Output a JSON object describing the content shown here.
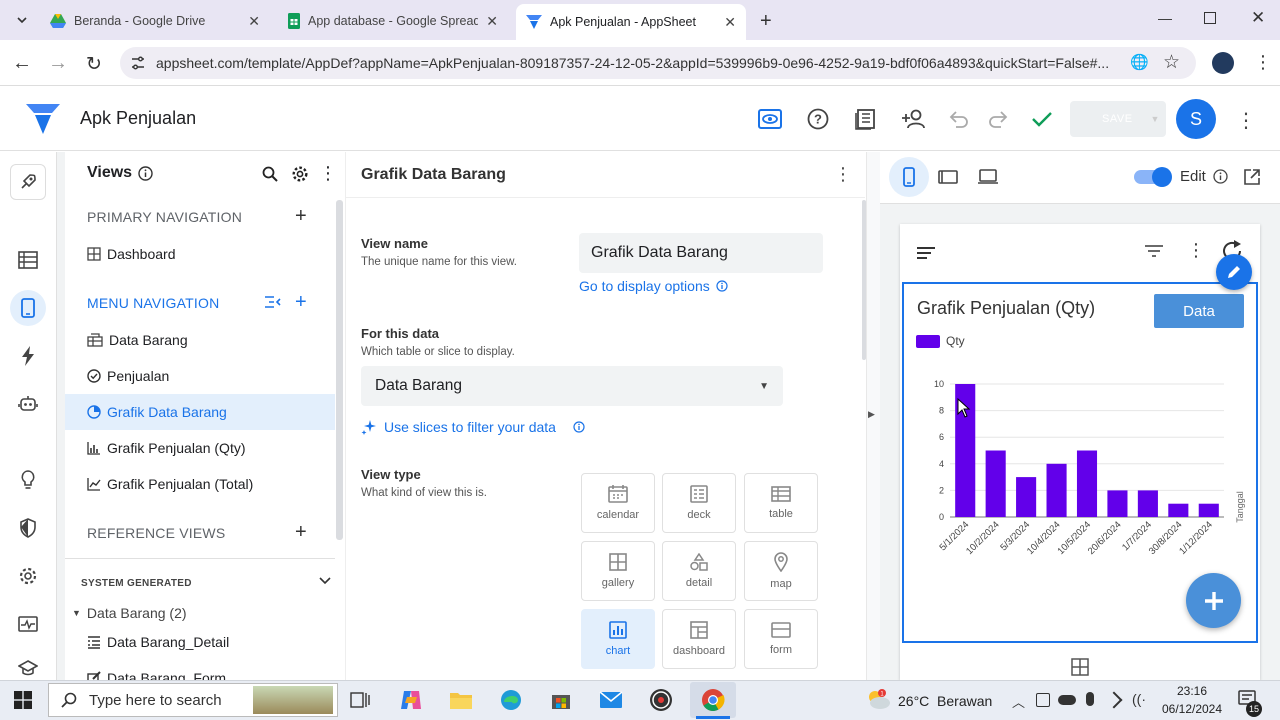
{
  "browser": {
    "tabs": [
      {
        "title": "Beranda - Google Drive",
        "icon": "google-drive-icon",
        "active": false
      },
      {
        "title": "App database - Google Spread",
        "icon": "google-sheets-icon",
        "active": false
      },
      {
        "title": "Apk Penjualan - AppSheet",
        "icon": "appsheet-icon",
        "active": true
      }
    ],
    "url": "appsheet.com/template/AppDef?appName=ApkPenjualan-809187357-24-12-05-2&appId=539996b9-0e96-4252-9a19-bdf0f06a4893&quickStart=False#..."
  },
  "app": {
    "title": "Apk Penjualan",
    "save_label": "SAVE",
    "avatar_letter": "S"
  },
  "views_panel": {
    "title": "Views",
    "primary_nav_label": "PRIMARY NAVIGATION",
    "primary_items": [
      {
        "label": "Dashboard",
        "icon": "grid-icon"
      }
    ],
    "menu_nav_label": "MENU NAVIGATION",
    "menu_items": [
      {
        "label": "Data Barang",
        "icon": "table-icon"
      },
      {
        "label": "Penjualan",
        "icon": "check-circle-icon"
      },
      {
        "label": "Grafik Data Barang",
        "icon": "pie-chart-icon",
        "selected": true
      },
      {
        "label": "Grafik Penjualan (Qty)",
        "icon": "bar-chart-icon"
      },
      {
        "label": "Grafik Penjualan (Total)",
        "icon": "line-chart-icon"
      }
    ],
    "reference_label": "REFERENCE VIEWS",
    "system_label": "SYSTEM GENERATED",
    "system_group": "Data Barang (2)",
    "system_items": [
      "Data Barang_Detail",
      "Data Barang_Form"
    ]
  },
  "editor": {
    "title": "Grafik Data Barang",
    "view_name_label": "View name",
    "view_name_hint": "The unique name for this view.",
    "view_name_value": "Grafik Data Barang",
    "display_link": "Go to display options",
    "for_data_label": "For this data",
    "for_data_hint": "Which table or slice to display.",
    "for_data_value": "Data Barang",
    "slices_link": "Use slices to filter your data",
    "view_type_label": "View type",
    "view_type_hint": "What kind of view this is.",
    "view_types": [
      "calendar",
      "deck",
      "table",
      "gallery",
      "detail",
      "map",
      "chart",
      "dashboard",
      "form"
    ],
    "selected_view_type": "chart"
  },
  "preview": {
    "edit_label": "Edit",
    "chart_title": "Grafik Penjualan (Qty)",
    "data_button": "Data",
    "accent": "#6200ea"
  },
  "chart_data": {
    "type": "bar",
    "categories": [
      "5/1/2024",
      "10/2/2024",
      "5/3/2024",
      "10/4/2024",
      "10/5/2024",
      "20/6/2024",
      "1/7/2024",
      "30/8/2024",
      "1/12/2024"
    ],
    "series": [
      {
        "name": "Qty",
        "values": [
          10,
          5,
          3,
          4,
          5,
          2,
          2,
          1,
          1
        ]
      }
    ],
    "yticks": [
      "0",
      "2",
      "4",
      "6",
      "8",
      "10"
    ],
    "ylim": [
      0,
      10
    ],
    "xlabel": "Tanggal",
    "title": "Grafik Penjualan (Qty)"
  },
  "taskbar": {
    "search_placeholder": "Type here to search",
    "weather": "26°C  Berawan",
    "time": "23:16",
    "date": "06/12/2024",
    "notif_count": "15"
  }
}
